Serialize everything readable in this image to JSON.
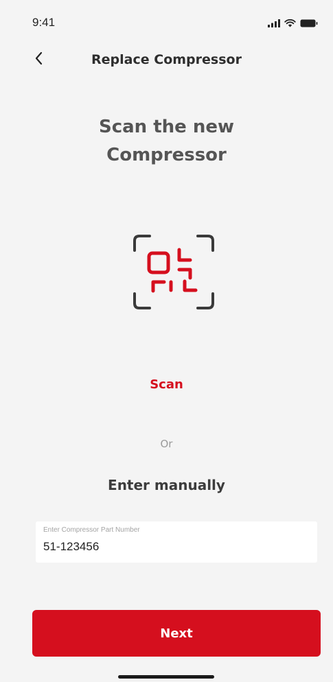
{
  "status_bar": {
    "time": "9:41",
    "icons": [
      "signal-icon",
      "wifi-icon",
      "battery-icon"
    ]
  },
  "nav": {
    "title": "Replace Compressor",
    "back_icon": "chevron-left-icon"
  },
  "heading": {
    "line1": "Scan the new",
    "line2": "Compressor"
  },
  "scan": {
    "icon": "qr-scan-icon",
    "label": "Scan"
  },
  "divider_text": "Or",
  "manual": {
    "label": "Enter manually",
    "field_label": "Enter Compressor Part Number",
    "field_value": "51-123456"
  },
  "next_button": {
    "label": "Next"
  },
  "colors": {
    "accent": "#d50f1e",
    "background": "#f4f4f4",
    "icon_dark": "#3a3a3a"
  }
}
